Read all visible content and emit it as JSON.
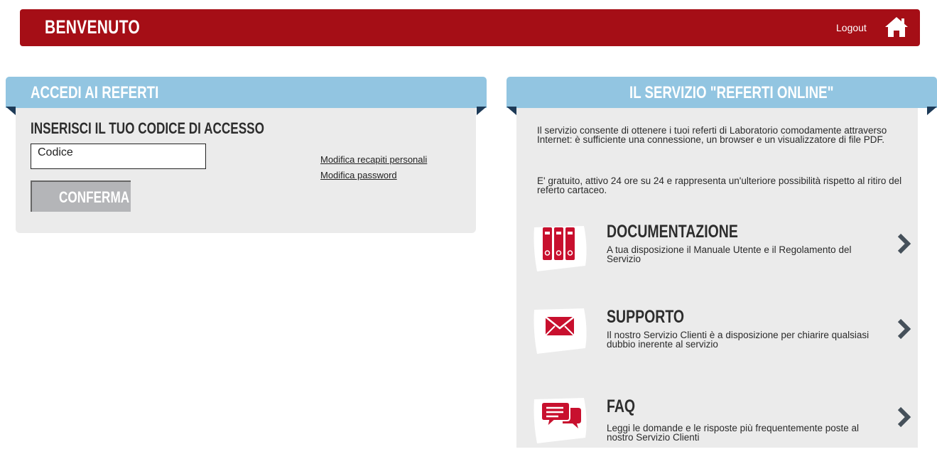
{
  "header": {
    "title": "BENVENUTO",
    "logout_label": "Logout",
    "home_icon": "home-icon"
  },
  "colors": {
    "header_bg": "#a50e16",
    "panel_head_bg": "#92c5e1",
    "panel_body_bg": "#ebebeb",
    "button_bg": "#b4b5b8",
    "icon_red": "#c8102e"
  },
  "login_panel": {
    "title": "ACCEDI AI REFERTI",
    "heading": "INSERISCI IL TUO CODICE DI ACCESSO",
    "code_value": "Codice",
    "confirm_label": "CONFERMA",
    "links": {
      "edit_contacts": "Modifica recapiti personali",
      "edit_password": "Modifica password"
    }
  },
  "service_panel": {
    "title": "IL SERVIZIO \"REFERTI ONLINE\"",
    "intro_1": "Il servizio consente di ottenere i tuoi referti di Laboratorio comodamente attraverso Internet: è sufficiente una connessione, un browser e un visualizzatore di file PDF.",
    "intro_2": "E' gratuito, attivo 24 ore su 24 e rappresenta un'ulteriore possibilità rispetto al ritiro del referto cartaceo.",
    "items": [
      {
        "title": "DOCUMENTAZIONE",
        "description": "A tua disposizione il Manuale Utente e il Regolamento del Servizio",
        "icon": "binders-icon"
      },
      {
        "title": "SUPPORTO",
        "description": "Il nostro Servizio Clienti è a disposizione per chiarire qualsiasi dubbio inerente al servizio",
        "icon": "envelope-icon"
      },
      {
        "title": "FAQ",
        "description": "Leggi le domande e le risposte più frequentemente poste al nostro Servizio Clienti",
        "icon": "chat-bubbles-icon"
      }
    ]
  }
}
